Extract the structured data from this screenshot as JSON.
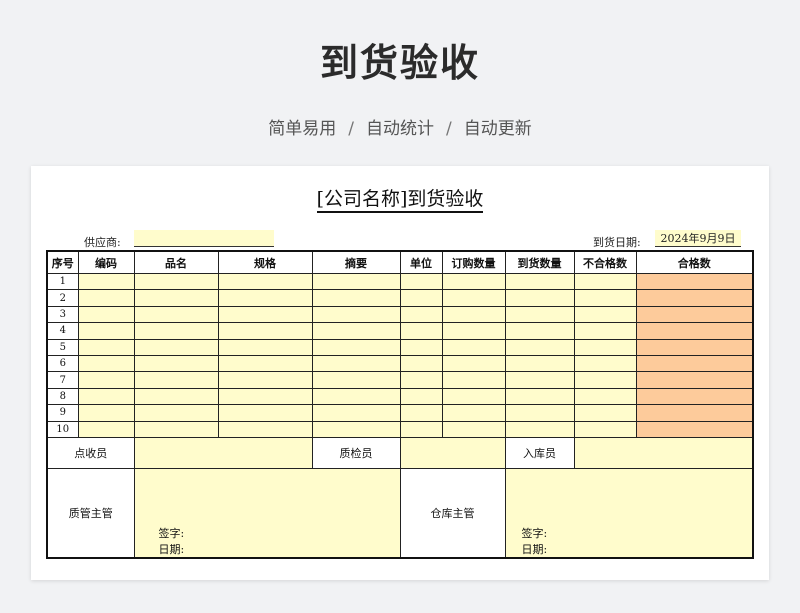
{
  "header": {
    "title": "到货验收",
    "subtitle_items": [
      "简单易用",
      "自动统计",
      "自动更新"
    ],
    "separator": "/"
  },
  "form": {
    "title": "[公司名称]到货验收",
    "supplier_label": "供应商:",
    "supplier_value": "",
    "arrival_date_label": "到货日期:",
    "arrival_date_value": "2024年9月9日",
    "columns": [
      "序号",
      "编码",
      "品名",
      "规格",
      "摘要",
      "单位",
      "订购数量",
      "到货数量",
      "不合格数",
      "合格数"
    ],
    "row_numbers": [
      "1",
      "2",
      "3",
      "4",
      "5",
      "6",
      "7",
      "8",
      "9",
      "10"
    ],
    "signoff": {
      "receiver_label": "点收员",
      "inspector_label": "质检员",
      "warehouse_in_label": "入库员"
    },
    "managers": {
      "quality_manager_label": "质管主管",
      "warehouse_manager_label": "仓库主管",
      "signature_label": "签字:",
      "date_label": "日期:"
    }
  },
  "colors": {
    "input_fill": "#fffccc",
    "qualified_fill": "#fdcb9b",
    "background": "#f1f2f4"
  }
}
